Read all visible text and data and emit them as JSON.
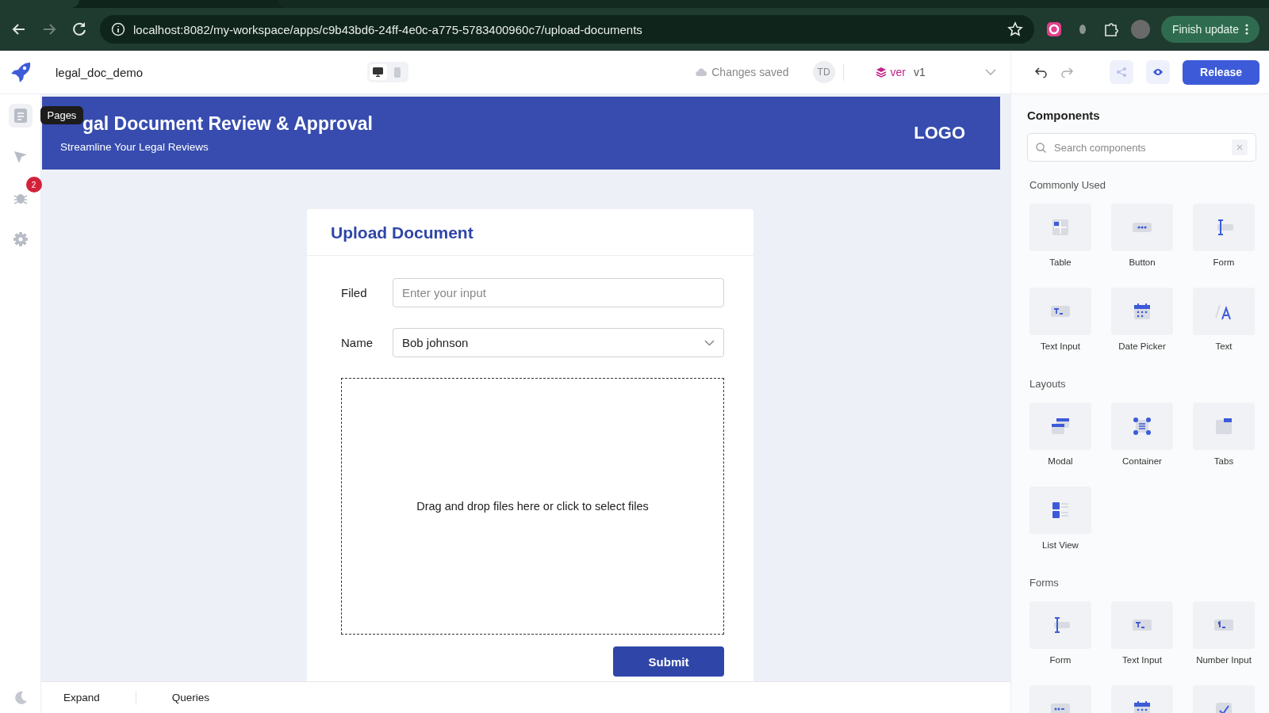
{
  "browser": {
    "url": "localhost:8082/my-workspace/apps/c9b43bd6-24ff-4e0c-a775-5783400960c7/upload-documents",
    "update_button": "Finish update"
  },
  "app_header": {
    "app_name": "legal_doc_demo",
    "device_toggle": [
      {
        "kind": "desktop",
        "selected": true
      },
      {
        "kind": "mobile",
        "selected": false
      }
    ],
    "save_status": "Changes saved",
    "user_initials": "TD",
    "version_label": "ver",
    "version": "v1",
    "release_button": "Release"
  },
  "left_rail": {
    "items": [
      {
        "kind": "pages",
        "tooltip": "Pages"
      },
      {
        "kind": "cursor"
      },
      {
        "kind": "bug",
        "badge": "2"
      },
      {
        "kind": "settings"
      }
    ]
  },
  "canvas": {
    "banner": {
      "title": "gal Document Review & Approval",
      "subtitle": "Streamline Your Legal Reviews",
      "logo": "LOGO"
    },
    "form": {
      "title": "Upload Document",
      "fields": [
        {
          "kind": "text",
          "label": "Filed",
          "placeholder": "Enter your input"
        },
        {
          "kind": "select",
          "label": "Name",
          "value": "Bob johnson"
        }
      ],
      "dropzone": "Drag and drop files here or click to select files",
      "submit": "Submit"
    }
  },
  "bottom_bar": [
    "Expand",
    "Queries"
  ],
  "components_panel": {
    "title": "Components",
    "search_placeholder": "Search components",
    "sections": [
      {
        "title": "Commonly Used",
        "items": [
          {
            "kind": "table",
            "label": "Table"
          },
          {
            "kind": "button",
            "label": "Button"
          },
          {
            "kind": "form",
            "label": "Form"
          },
          {
            "kind": "text-input",
            "label": "Text Input"
          },
          {
            "kind": "date-picker",
            "label": "Date Picker"
          },
          {
            "kind": "text",
            "label": "Text"
          }
        ]
      },
      {
        "title": "Layouts",
        "items": [
          {
            "kind": "modal",
            "label": "Modal"
          },
          {
            "kind": "container",
            "label": "Container"
          },
          {
            "kind": "tabs",
            "label": "Tabs"
          },
          {
            "kind": "list-view",
            "label": "List View"
          }
        ]
      },
      {
        "title": "Forms",
        "items": [
          {
            "kind": "form",
            "label": "Form"
          },
          {
            "kind": "text-input",
            "label": "Text Input"
          },
          {
            "kind": "number-input",
            "label": "Number Input"
          },
          {
            "kind": "password"
          },
          {
            "kind": "date-picker"
          },
          {
            "kind": "checkbox"
          }
        ]
      }
    ]
  }
}
